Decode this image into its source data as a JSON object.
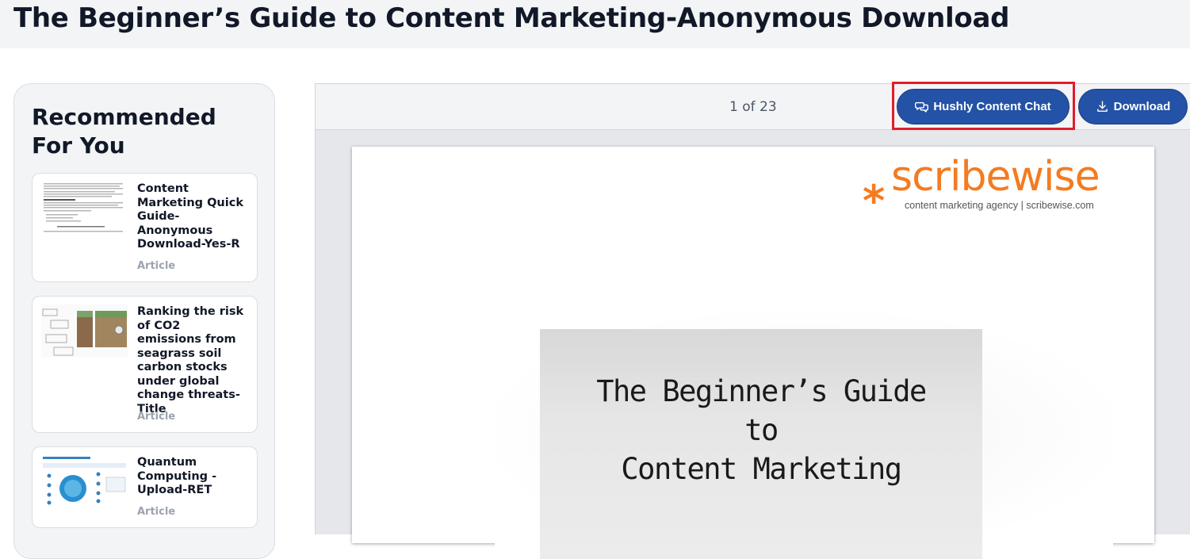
{
  "header": {
    "title": "The Beginner’s Guide to Content Marketing-Anonymous Download"
  },
  "sidebar": {
    "heading": "Recommended For You",
    "items": [
      {
        "title": "Content Marketing Quick Guide-Anonymous Download-Yes-R",
        "type": "Article"
      },
      {
        "title": "Ranking the risk of CO2 emissions from seagrass soil carbon stocks under global change threats-Title",
        "type": "Article"
      },
      {
        "title": "Quantum Computing - Upload-RET",
        "type": "Article"
      }
    ]
  },
  "viewer": {
    "page_counter": "1 of 23",
    "chat_button": "Hushly Content Chat",
    "download_button": "Download"
  },
  "document": {
    "logo_word": "scribewise",
    "logo_tagline": "content marketing agency | scribewise.com",
    "title_line1": "The Beginner’s Guide",
    "title_line2": "to",
    "title_line3": "Content Marketing"
  },
  "colors": {
    "accent": "#2352a6",
    "highlight": "#e11d2a",
    "brand_orange": "#f47b20"
  }
}
